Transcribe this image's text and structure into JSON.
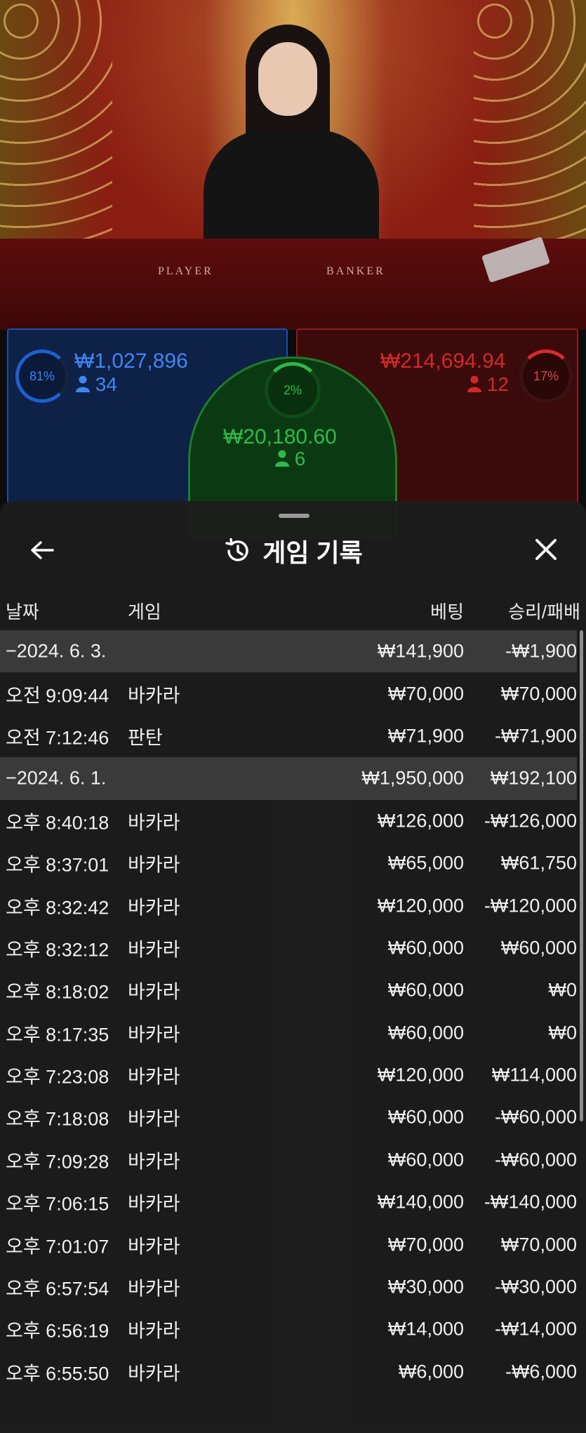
{
  "stream": {
    "felt_left": "PLAYER",
    "felt_right": "BANKER"
  },
  "bets": {
    "player": {
      "percent": "81%",
      "amount": "₩1,027,896",
      "players": "34"
    },
    "tie": {
      "percent": "2%",
      "amount": "₩20,180.60",
      "players": "6"
    },
    "banker": {
      "percent": "17%",
      "amount": "₩214,694.94",
      "players": "12"
    }
  },
  "history": {
    "title": "게임 기록",
    "columns": {
      "date": "날짜",
      "game": "게임",
      "bet": "베팅",
      "win_loss": "승리/패배"
    },
    "rows": [
      {
        "type": "day",
        "time": "−2024. 6. 3.",
        "game": "",
        "bet": "₩141,900",
        "win_loss": "-₩1,900"
      },
      {
        "type": "entry",
        "time": "오전 9:09:44",
        "game": "바카라",
        "bet": "₩70,000",
        "win_loss": "₩70,000"
      },
      {
        "type": "entry",
        "time": "오전 7:12:46",
        "game": "판탄",
        "bet": "₩71,900",
        "win_loss": "-₩71,900"
      },
      {
        "type": "day",
        "time": "−2024. 6. 1.",
        "game": "",
        "bet": "₩1,950,000",
        "win_loss": "₩192,100"
      },
      {
        "type": "entry",
        "time": "오후 8:40:18",
        "game": "바카라",
        "bet": "₩126,000",
        "win_loss": "-₩126,000"
      },
      {
        "type": "entry",
        "time": "오후 8:37:01",
        "game": "바카라",
        "bet": "₩65,000",
        "win_loss": "₩61,750"
      },
      {
        "type": "entry",
        "time": "오후 8:32:42",
        "game": "바카라",
        "bet": "₩120,000",
        "win_loss": "-₩120,000"
      },
      {
        "type": "entry",
        "time": "오후 8:32:12",
        "game": "바카라",
        "bet": "₩60,000",
        "win_loss": "₩60,000"
      },
      {
        "type": "entry",
        "time": "오후 8:18:02",
        "game": "바카라",
        "bet": "₩60,000",
        "win_loss": "₩0"
      },
      {
        "type": "entry",
        "time": "오후 8:17:35",
        "game": "바카라",
        "bet": "₩60,000",
        "win_loss": "₩0"
      },
      {
        "type": "entry",
        "time": "오후 7:23:08",
        "game": "바카라",
        "bet": "₩120,000",
        "win_loss": "₩114,000"
      },
      {
        "type": "entry",
        "time": "오후 7:18:08",
        "game": "바카라",
        "bet": "₩60,000",
        "win_loss": "-₩60,000"
      },
      {
        "type": "entry",
        "time": "오후 7:09:28",
        "game": "바카라",
        "bet": "₩60,000",
        "win_loss": "-₩60,000"
      },
      {
        "type": "entry",
        "time": "오후 7:06:15",
        "game": "바카라",
        "bet": "₩140,000",
        "win_loss": "-₩140,000"
      },
      {
        "type": "entry",
        "time": "오후 7:01:07",
        "game": "바카라",
        "bet": "₩70,000",
        "win_loss": "₩70,000"
      },
      {
        "type": "entry",
        "time": "오후 6:57:54",
        "game": "바카라",
        "bet": "₩30,000",
        "win_loss": "-₩30,000"
      },
      {
        "type": "entry",
        "time": "오후 6:56:19",
        "game": "바카라",
        "bet": "₩14,000",
        "win_loss": "-₩14,000"
      },
      {
        "type": "entry",
        "time": "오후 6:55:50",
        "game": "바카라",
        "bet": "₩6,000",
        "win_loss": "-₩6,000"
      }
    ]
  },
  "icons": {
    "back": "arrow-left-icon",
    "history": "history-clock-icon",
    "close": "close-icon",
    "user": "user-icon"
  },
  "colors": {
    "player": "#3f86f5",
    "banker": "#d42828",
    "tie": "#2dbb4c",
    "sheet_bg": "#1c1c1c",
    "day_row_bg": "#3a3a3a"
  }
}
